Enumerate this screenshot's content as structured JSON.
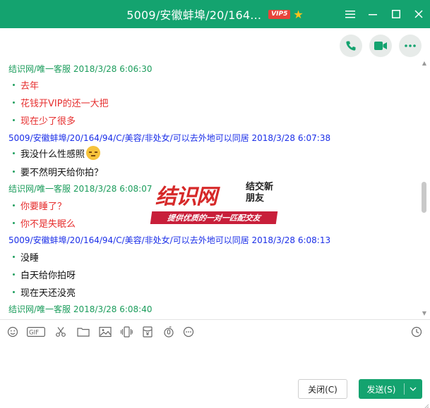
{
  "window": {
    "title": "5009/安徽蚌埠/20/164...",
    "vip_label": "VIP5",
    "star": "★",
    "accent_color": "#14a36f",
    "controls": [
      "menu-icon",
      "minimize-icon",
      "maximize-icon",
      "close-icon"
    ]
  },
  "actions": [
    "phone-icon",
    "video-icon",
    "more-icon"
  ],
  "messages": [
    {
      "header": "结识网/唯一客服 2018/3/28 6:06:30",
      "sender_color": "green",
      "lines": [
        "去年",
        "花钱开VIP的还一大把",
        "现在少了很多"
      ],
      "line_color": "red"
    },
    {
      "header": "5009/安徽蚌埠/20/164/94/C/美容/非处女/可以去外地可以同居 2018/3/28 6:07:38",
      "sender_color": "blue",
      "lines": [
        "我没什么性感照",
        "要不然明天给你拍？"
      ],
      "line_color": "black",
      "emoji_on_line": 0
    },
    {
      "header": "结识网/唯一客服 2018/3/28 6:08:07",
      "sender_color": "green",
      "lines": [
        "你要睡了？",
        "你不是失眠么"
      ],
      "line_color": "red"
    },
    {
      "header": "5009/安徽蚌埠/20/164/94/C/美容/非处女/可以去外地可以同居 2018/3/28 6:08:13",
      "sender_color": "blue",
      "lines": [
        "没睡",
        "白天给你拍呀",
        "现在天还没亮"
      ],
      "line_color": "black"
    },
    {
      "header": "结识网/唯一客服 2018/3/28 6:08:40",
      "sender_color": "green",
      "lines": [],
      "line_color": "red"
    }
  ],
  "watermark": {
    "brand": "结识网",
    "slogan_side": "结交新朋友",
    "slogan_bar": "提供优质的一对一匹配交友"
  },
  "toolbar": {
    "items": [
      "emoji-icon",
      "gif-icon",
      "scissors-icon",
      "folder-icon",
      "image-icon",
      "shake-icon",
      "red-packet-icon",
      "voice-icon",
      "more-tools-icon",
      "history-icon"
    ],
    "gif_label": "GIF"
  },
  "input": {
    "value": ""
  },
  "buttons": {
    "close_label": "关闭(C)",
    "send_label": "发送(S)"
  }
}
